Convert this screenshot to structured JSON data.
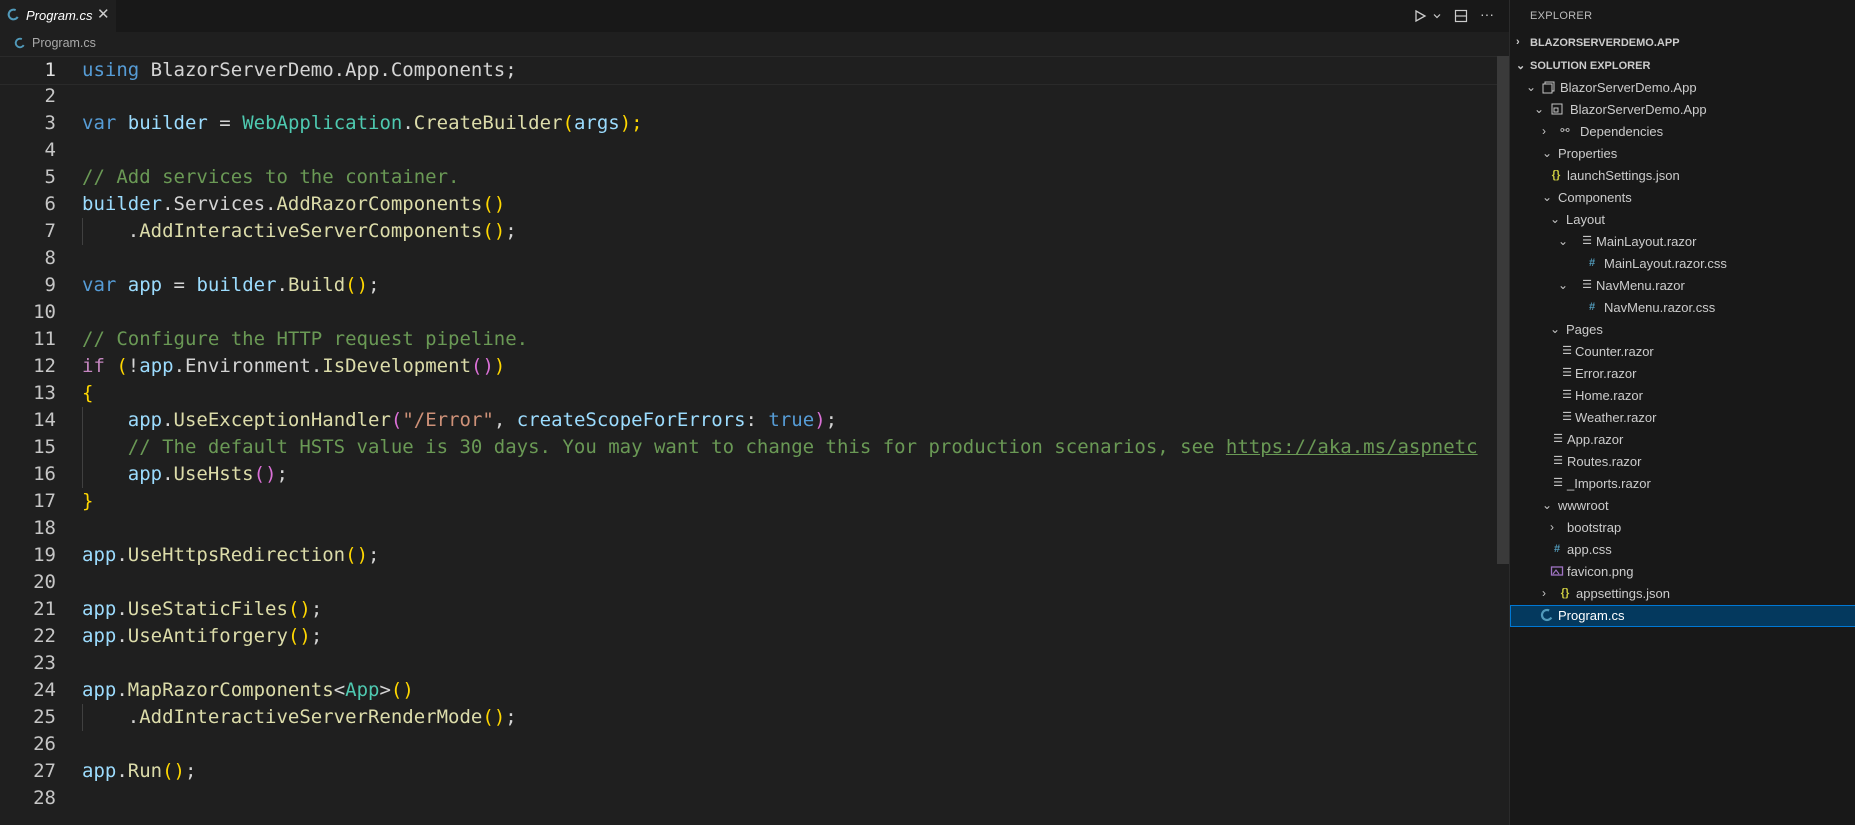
{
  "tab": {
    "label": "Program.cs",
    "close": "✕"
  },
  "breadcrumb": {
    "file": "Program.cs"
  },
  "toolbar": {
    "run": "▷",
    "dropdown": "⌄",
    "split": "▣",
    "more": "···"
  },
  "code_lines": [
    {
      "n": "1"
    },
    {
      "n": "2"
    },
    {
      "n": "3"
    },
    {
      "n": "4"
    },
    {
      "n": "5"
    },
    {
      "n": "6"
    },
    {
      "n": "7"
    },
    {
      "n": "8"
    },
    {
      "n": "9"
    },
    {
      "n": "10"
    },
    {
      "n": "11"
    },
    {
      "n": "12"
    },
    {
      "n": "13"
    },
    {
      "n": "14"
    },
    {
      "n": "15"
    },
    {
      "n": "16"
    },
    {
      "n": "17"
    },
    {
      "n": "18"
    },
    {
      "n": "19"
    },
    {
      "n": "20"
    },
    {
      "n": "21"
    },
    {
      "n": "22"
    },
    {
      "n": "23"
    },
    {
      "n": "24"
    },
    {
      "n": "25"
    },
    {
      "n": "26"
    },
    {
      "n": "27"
    },
    {
      "n": "28"
    }
  ],
  "code": {
    "l1": {
      "a": "using",
      "b": " BlazorServerDemo.App.Components;"
    },
    "l3": {
      "a": "var",
      "b": " ",
      "c": "builder",
      "d": " = ",
      "e": "WebApplication",
      "f": ".",
      "g": "CreateBuilder",
      "h": "(",
      "i": "args",
      "j": ");"
    },
    "l5": {
      "a": "// Add services to the container."
    },
    "l6": {
      "a": "builder",
      "b": ".Services.",
      "c": "AddRazorComponents",
      "d": "()"
    },
    "l7": {
      "a": "    .",
      "b": "AddInteractiveServerComponents",
      "c": "()",
      "d": ";"
    },
    "l9": {
      "a": "var",
      "b": " ",
      "c": "app",
      "d": " = ",
      "e": "builder",
      "f": ".",
      "g": "Build",
      "h": "()",
      "i": ";"
    },
    "l11": {
      "a": "// Configure the HTTP request pipeline."
    },
    "l12": {
      "a": "if",
      "b": " ",
      "c": "(",
      "d": "!",
      "e": "app",
      "f": ".Environment.",
      "g": "IsDevelopment",
      "h": "()",
      "i": ")"
    },
    "l13": {
      "a": "{"
    },
    "l14": {
      "a": "    ",
      "b": "app",
      "c": ".",
      "d": "UseExceptionHandler",
      "e": "(",
      "f": "\"/Error\"",
      "g": ", ",
      "h": "createScopeForErrors",
      "i": ": ",
      "j": "true",
      "k": ")",
      "l": ";"
    },
    "l15": {
      "a": "    // The default HSTS value is 30 days. You may want to change this for production scenarios, see ",
      "b": "https://aka.ms/aspnetc"
    },
    "l16": {
      "a": "    ",
      "b": "app",
      "c": ".",
      "d": "UseHsts",
      "e": "()",
      "f": ";"
    },
    "l17": {
      "a": "}"
    },
    "l19": {
      "a": "app",
      "b": ".",
      "c": "UseHttpsRedirection",
      "d": "()",
      "e": ";"
    },
    "l21": {
      "a": "app",
      "b": ".",
      "c": "UseStaticFiles",
      "d": "()",
      "e": ";"
    },
    "l22": {
      "a": "app",
      "b": ".",
      "c": "UseAntiforgery",
      "d": "()",
      "e": ";"
    },
    "l24": {
      "a": "app",
      "b": ".",
      "c": "MapRazorComponents",
      "d": "<",
      "e": "App",
      "f": ">",
      "g": "()"
    },
    "l25": {
      "a": "    .",
      "b": "AddInteractiveServerRenderMode",
      "c": "()",
      "d": ";"
    },
    "l27": {
      "a": "app",
      "b": ".",
      "c": "Run",
      "d": "()",
      "e": ";"
    }
  },
  "explorer": {
    "title": "EXPLORER",
    "workspace": "BLAZORSERVERDEMO.APP",
    "solution": "SOLUTION EXPLORER",
    "items": [
      {
        "label": "BlazorServerDemo.App"
      },
      {
        "label": "BlazorServerDemo.App"
      },
      {
        "label": "Dependencies"
      },
      {
        "label": "Properties"
      },
      {
        "label": "launchSettings.json"
      },
      {
        "label": "Components"
      },
      {
        "label": "Layout"
      },
      {
        "label": "MainLayout.razor"
      },
      {
        "label": "MainLayout.razor.css"
      },
      {
        "label": "NavMenu.razor"
      },
      {
        "label": "NavMenu.razor.css"
      },
      {
        "label": "Pages"
      },
      {
        "label": "Counter.razor"
      },
      {
        "label": "Error.razor"
      },
      {
        "label": "Home.razor"
      },
      {
        "label": "Weather.razor"
      },
      {
        "label": "App.razor"
      },
      {
        "label": "Routes.razor"
      },
      {
        "label": "_Imports.razor"
      },
      {
        "label": "wwwroot"
      },
      {
        "label": "bootstrap"
      },
      {
        "label": "app.css"
      },
      {
        "label": "favicon.png"
      },
      {
        "label": "appsettings.json"
      },
      {
        "label": "Program.cs"
      }
    ]
  },
  "colors": {
    "accent": "#0078d4",
    "selection": "#04395e",
    "editor_bg": "#1f1f1f",
    "sidebar_bg": "#181818"
  }
}
